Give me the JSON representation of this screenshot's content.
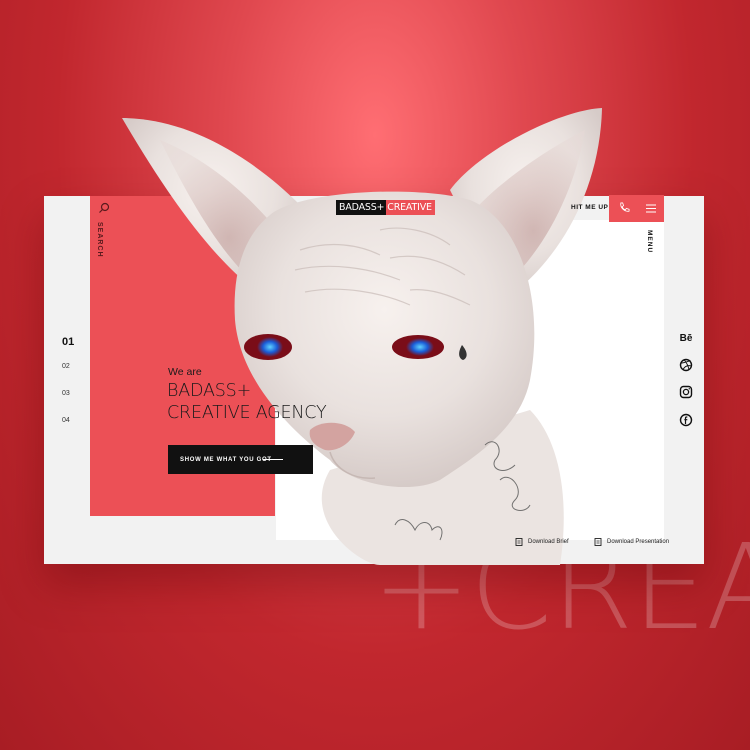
{
  "background_text": "+CREA",
  "colors": {
    "accent": "#ec5056",
    "background": "#c1272e",
    "dark": "#111111"
  },
  "header": {
    "logo_left": "BADASS+",
    "logo_right": "CREATIVE",
    "contact_label": "HIT ME UP",
    "phone_icon": "phone-icon",
    "menu_icon": "hamburger-icon",
    "menu_label": "MENU"
  },
  "sidebar": {
    "search_icon": "search-icon",
    "search_label": "SEARCH"
  },
  "pager": {
    "items": [
      "01",
      "02",
      "03",
      "04"
    ],
    "active": "01"
  },
  "hero": {
    "intro": "We are",
    "headline_line1": "BADASS+",
    "headline_line2": "CREATIVE AGENCY",
    "cta_label": "SHOW ME WHAT YOU GOT"
  },
  "social": {
    "behance": "Bē",
    "icons": [
      "behance-icon",
      "dribbble-icon",
      "instagram-icon",
      "facebook-icon"
    ]
  },
  "downloads": {
    "brief": "Download Brief",
    "presentation": "Download Presentation"
  }
}
